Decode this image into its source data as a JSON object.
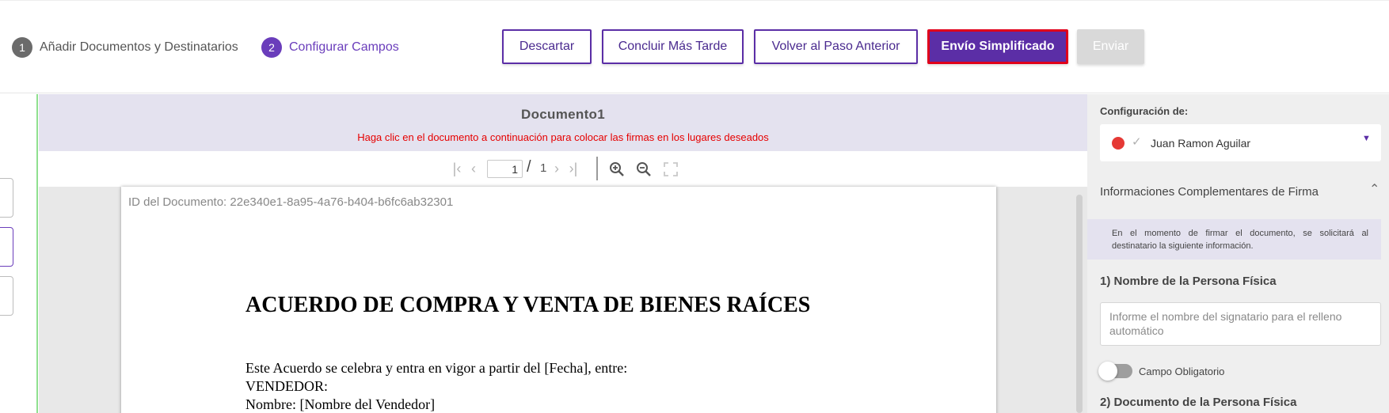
{
  "colors": {
    "accent": "#5b2ea6",
    "highlight_border": "#e0001b",
    "hint_text": "#e60000",
    "signer_dot": "#e53935",
    "doc_header_bg": "#e4e2ef"
  },
  "steps": [
    {
      "number": "1",
      "label": "Añadir Documentos y Destinatarios",
      "state": "completed"
    },
    {
      "number": "2",
      "label": "Configurar Campos",
      "state": "active"
    }
  ],
  "actions": {
    "descartar": "Descartar",
    "concluir": "Concluir Más Tarde",
    "volver": "Volver al Paso Anterior",
    "envio_simplificado": "Envío Simplificado",
    "enviar": "Enviar"
  },
  "document": {
    "title": "Documento1",
    "hint": "Haga clic en el documento a continuación para colocar las firmas en los lugares deseados",
    "toolbar": {
      "current_page": "1",
      "separator": "/",
      "total_pages": "1",
      "icons": [
        "first-page-icon",
        "prev-page-icon",
        "next-page-icon",
        "last-page-icon",
        "zoom-in-icon",
        "zoom-out-icon",
        "fullscreen-icon"
      ]
    },
    "page": {
      "id_line": "ID del Documento: 22e340e1-8a95-4a76-b404-b6fc6ab32301",
      "heading": "ACUERDO DE COMPRA Y VENTA DE BIENES RAÍCES",
      "lines": [
        "Este Acuerdo se celebra y entra en vigor a partir del [Fecha], entre:",
        "VENDEDOR:",
        "Nombre: [Nombre del Vendedor]"
      ]
    }
  },
  "panel": {
    "config_label": "Configuración de:",
    "signer_name": "Juan Ramon Aguilar",
    "section_title": "Informaciones Complementares de Firma",
    "info_text": "En el momento de firmar el documento, se solicitará al destinatario la siguiente información.",
    "field1": {
      "title": "1) Nombre de la Persona Física",
      "placeholder": "Informe el nombre del signatario para el relleno automático",
      "required_label": "Campo Obligatorio",
      "required": false
    },
    "field2_title": "2) Documento de la Persona Física"
  }
}
